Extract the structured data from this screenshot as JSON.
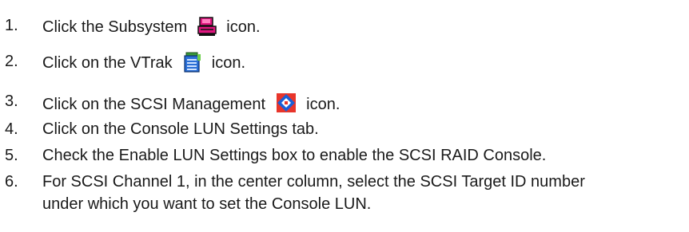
{
  "steps": [
    {
      "num": "1.",
      "before": "Click the Subsystem",
      "after": "icon.",
      "icon": "subsystem-icon"
    },
    {
      "num": "2.",
      "before": "Click on the VTrak",
      "after": "icon.",
      "icon": "vtrak-icon"
    },
    {
      "num": "3.",
      "before": "Click on the SCSI Management",
      "after": "icon.",
      "icon": "scsi-management-icon"
    },
    {
      "num": "4.",
      "text": "Click on the Console LUN Settings tab."
    },
    {
      "num": "5.",
      "text": "Check the Enable LUN Settings box to enable the SCSI RAID Console."
    },
    {
      "num": "6.",
      "line1": "For SCSI Channel 1, in the center column, select the SCSI Target ID number",
      "line2": "under which you want to set the Console LUN."
    }
  ]
}
